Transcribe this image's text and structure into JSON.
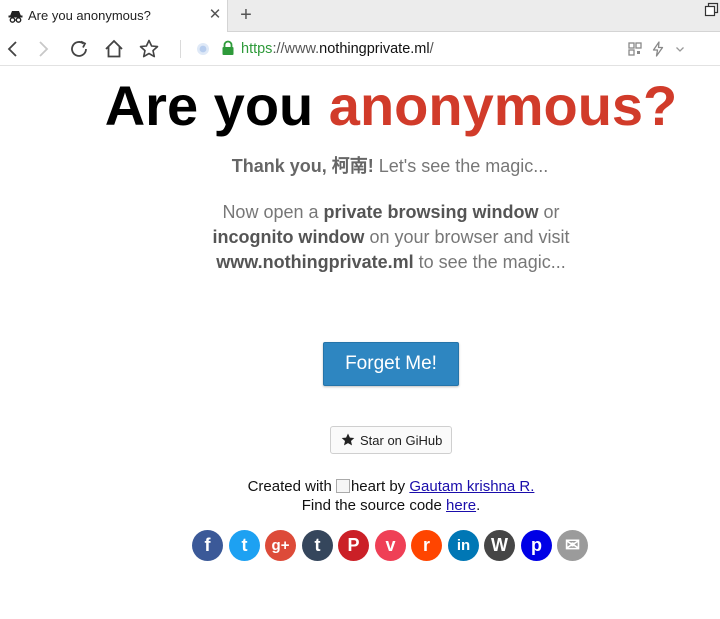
{
  "browser": {
    "tab": {
      "title": "Are you anonymous?",
      "close_glyph": "✕",
      "favicon": "spy-icon"
    },
    "new_tab_glyph": "+",
    "address": {
      "scheme": "https",
      "sep": "://www.",
      "host": "nothingprivate.ml",
      "path": "/"
    }
  },
  "page": {
    "headline_main": "Are you",
    "headline_accent": "anonymous?",
    "accent_color": "#d13b2a",
    "thanks_bold": "Thank you, 柯南!",
    "thanks_rest": " Let's see the magic...",
    "instr_1": "Now open a ",
    "instr_2_bold": "private browsing window",
    "instr_3": " or",
    "instr_4_bold": "incognito window",
    "instr_5": " on your browser and visit",
    "instr_6_bold": "www.nothingprivate.ml",
    "instr_7": " to see the magic...",
    "forget_button": "Forget Me!",
    "button_color": "#2e86c1",
    "github_button": "Star on GiHub",
    "credit_1": "Created with ",
    "credit_img_alt": "heart",
    "credit_2": " by ",
    "credit_author": "Gautam krishna R.",
    "source_1": "Find the source code ",
    "source_link": "here",
    "source_2": "."
  },
  "social": [
    {
      "name": "facebook-icon",
      "glyph": "f",
      "color": "#3b5998"
    },
    {
      "name": "twitter-icon",
      "glyph": "t",
      "color": "#1da1f2"
    },
    {
      "name": "google-plus-icon",
      "glyph": "g+",
      "color": "#dd4b39"
    },
    {
      "name": "tumblr-icon",
      "glyph": "t",
      "color": "#35465c"
    },
    {
      "name": "pinterest-icon",
      "glyph": "P",
      "color": "#cb2027"
    },
    {
      "name": "pocket-icon",
      "glyph": "v",
      "color": "#ef4056"
    },
    {
      "name": "reddit-icon",
      "glyph": "r",
      "color": "#ff4500"
    },
    {
      "name": "linkedin-icon",
      "glyph": "in",
      "color": "#0077b5"
    },
    {
      "name": "wordpress-icon",
      "glyph": "W",
      "color": "#464646"
    },
    {
      "name": "pinboard-icon",
      "glyph": "p",
      "color": "#0000e6"
    },
    {
      "name": "email-icon",
      "glyph": "✉",
      "color": "#9b9b9b"
    }
  ]
}
